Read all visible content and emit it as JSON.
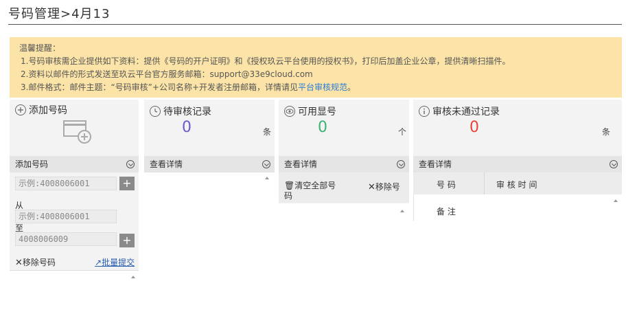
{
  "page": {
    "title": "号码管理>4月13"
  },
  "notice": {
    "heading": "温馨提醒：",
    "line1": "1.号码审核需企业提供如下资料：提供《号码的开户证明》和《授权玖云平台使用的授权书》，打印后加盖企业公章，提供清晰扫描件。",
    "line2": "2.资料以邮件的形式发送至玖云平台官方服务邮箱：support@33e9cloud.com",
    "line3_prefix": "3.邮件格式：邮件主题：“号码审核”+公司名称+开发者注册邮箱，详情请见",
    "line3_link": "平台审核规范",
    "line3_suffix": "。"
  },
  "panels": {
    "add": {
      "title": "添加号码",
      "bar_label": "添加号码",
      "single_input_placeholder": "示例:4008006001",
      "from_label": "从",
      "from_placeholder": "示例:4008006001",
      "to_label": "至",
      "to_value": "4008006009",
      "plus": "+",
      "remove_label": "移除号码",
      "batch_label": "批量提交"
    },
    "pending": {
      "title": "待审核记录",
      "count": "0",
      "unit": "条",
      "bar_label": "查看详情"
    },
    "available": {
      "title": "可用显号",
      "count": "0",
      "unit": "个",
      "bar_label": "查看详情",
      "clear_label": "清空全部号码",
      "remove_label": "移除号"
    },
    "rejected": {
      "title": "审核未通过记录",
      "count": "0",
      "unit": "条",
      "bar_label": "查看详情",
      "col_number": "号 码",
      "col_time": "审 核 时 间",
      "note": "备 注"
    }
  },
  "colors": {
    "pending_count": "#6a5acd",
    "available_count": "#3cb371",
    "rejected_count": "#e8443a",
    "link": "#2a7bd6",
    "notice_bg": "#fce4a8"
  }
}
